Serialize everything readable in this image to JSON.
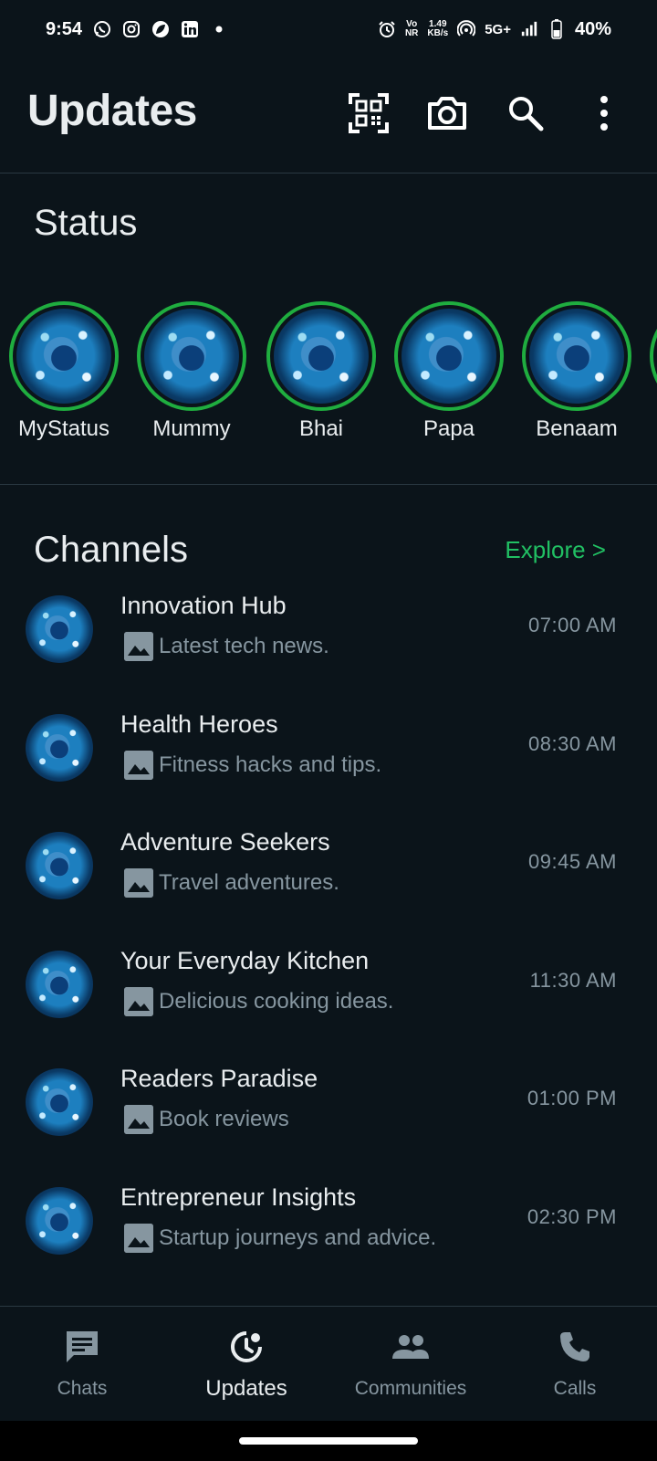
{
  "statusbar": {
    "time": "9:54",
    "speed_value": "1.49",
    "speed_unit": "KB/s",
    "network": "5G+",
    "battery": "40%",
    "left_icons": [
      "whatsapp-icon",
      "instagram-icon",
      "leaf-app-icon",
      "linkedin-icon",
      "dot-icon"
    ],
    "right_icons": [
      "alarm-icon",
      "volte-icon",
      "hotspot-icon",
      "signal-icon",
      "battery-icon"
    ]
  },
  "header": {
    "title": "Updates",
    "icons": [
      "qr-scan-icon",
      "camera-icon",
      "search-icon",
      "more-vert-icon"
    ]
  },
  "status": {
    "title": "Status",
    "items": [
      {
        "name": "MyStatus"
      },
      {
        "name": "Mummy"
      },
      {
        "name": "Bhai"
      },
      {
        "name": "Papa"
      },
      {
        "name": "Benaam"
      }
    ]
  },
  "channels": {
    "title": "Channels",
    "explore": "Explore >",
    "items": [
      {
        "name": "Innovation Hub",
        "preview": "Latest tech news.",
        "time": "07:00 AM"
      },
      {
        "name": "Health Heroes",
        "preview": "Fitness hacks and tips.",
        "time": "08:30 AM"
      },
      {
        "name": "Adventure Seekers",
        "preview": "Travel adventures.",
        "time": "09:45 AM"
      },
      {
        "name": "Your Everyday Kitchen",
        "preview": "Delicious cooking ideas.",
        "time": "11:30 AM"
      },
      {
        "name": "Readers Paradise",
        "preview": "Book reviews",
        "time": "01:00 PM"
      },
      {
        "name": "Entrepreneur Insights",
        "preview": "Startup journeys and advice.",
        "time": "02:30 PM"
      }
    ]
  },
  "bottom_nav": {
    "items": [
      {
        "label": "Chats",
        "icon": "chat-icon"
      },
      {
        "label": "Updates",
        "icon": "updates-icon",
        "active": true
      },
      {
        "label": "Communities",
        "icon": "communities-icon"
      },
      {
        "label": "Calls",
        "icon": "phone-icon"
      }
    ]
  },
  "colors": {
    "background": "#0b141a",
    "accent_green": "#21c063",
    "ring_green": "#1fad3f",
    "text_primary": "#e9edef",
    "text_secondary": "#8696a0"
  }
}
